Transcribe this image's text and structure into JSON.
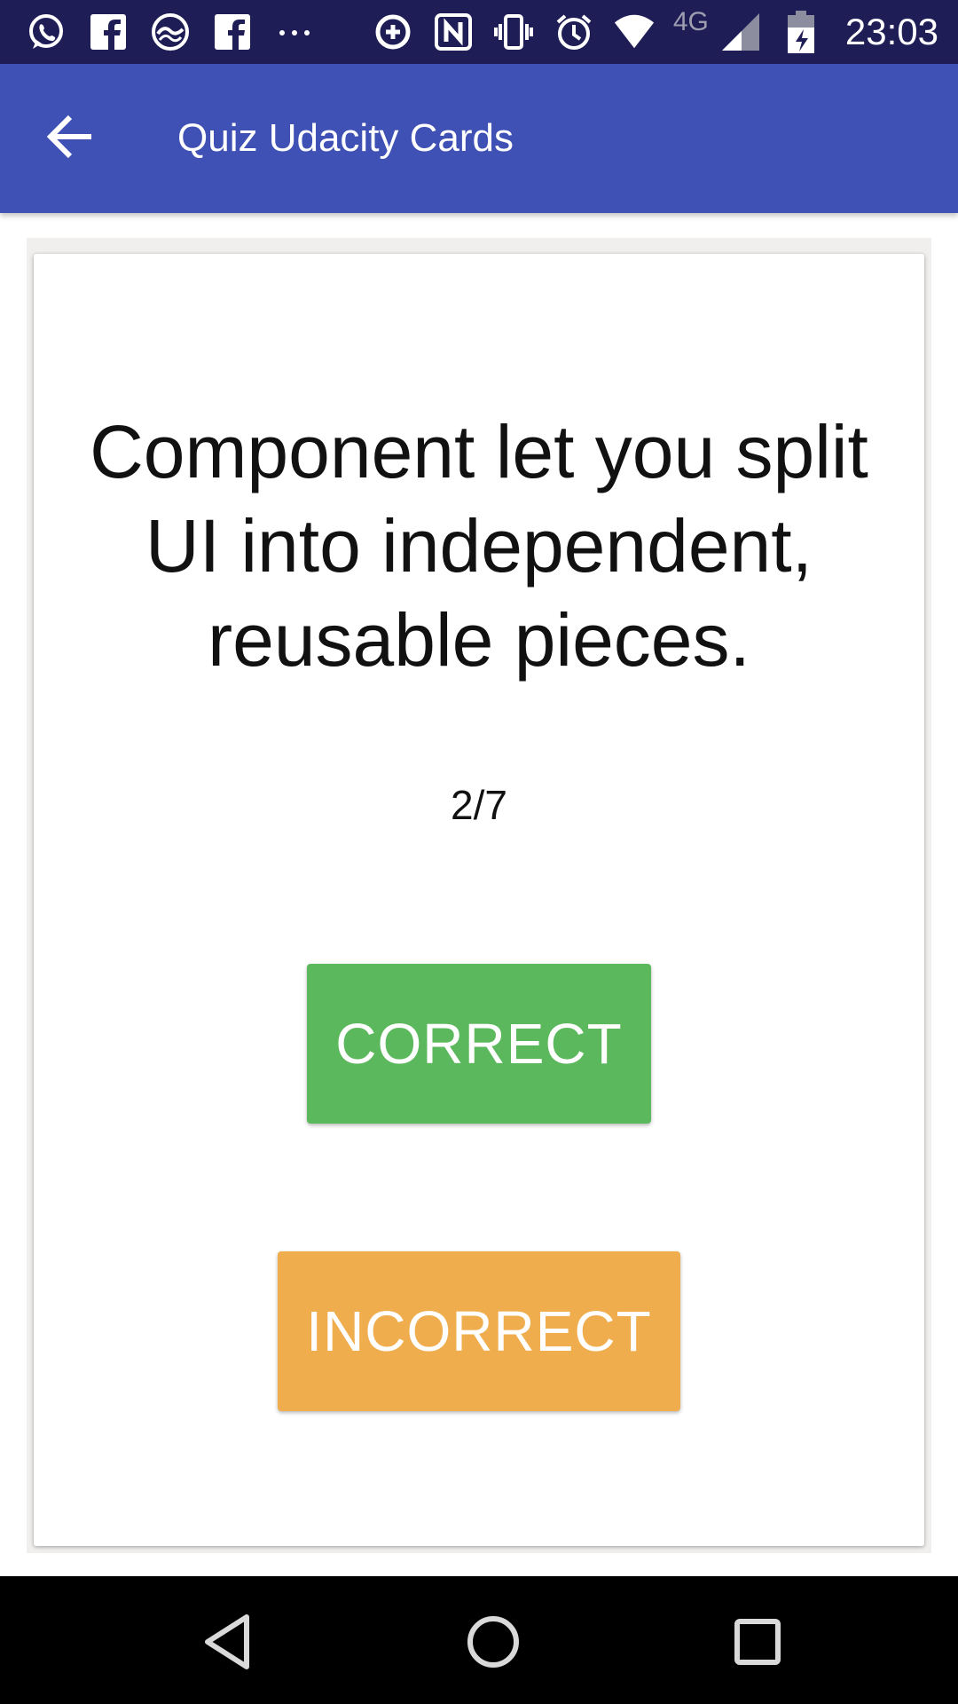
{
  "status_bar": {
    "network_type": "4G",
    "time": "23:03",
    "icons_left": [
      "whatsapp-icon",
      "facebook-icon",
      "app-icon",
      "facebook-icon",
      "more-icon"
    ],
    "icons_right": [
      "data-saver-icon",
      "nfc-icon",
      "vibrate-icon",
      "alarm-icon",
      "wifi-icon",
      "signal-icon",
      "battery-charging-icon"
    ]
  },
  "app_bar": {
    "title": "Quiz Udacity Cards",
    "color": "#3f51b5"
  },
  "card": {
    "question": "Component let you split UI into independent, reusable pieces.",
    "progress": "2/7",
    "correct_label": "CORRECT",
    "incorrect_label": "INCORRECT",
    "correct_color": "#5cb85c",
    "incorrect_color": "#efad4e"
  },
  "nav_bar": {
    "buttons": [
      "back-icon",
      "home-icon",
      "recents-icon"
    ]
  }
}
